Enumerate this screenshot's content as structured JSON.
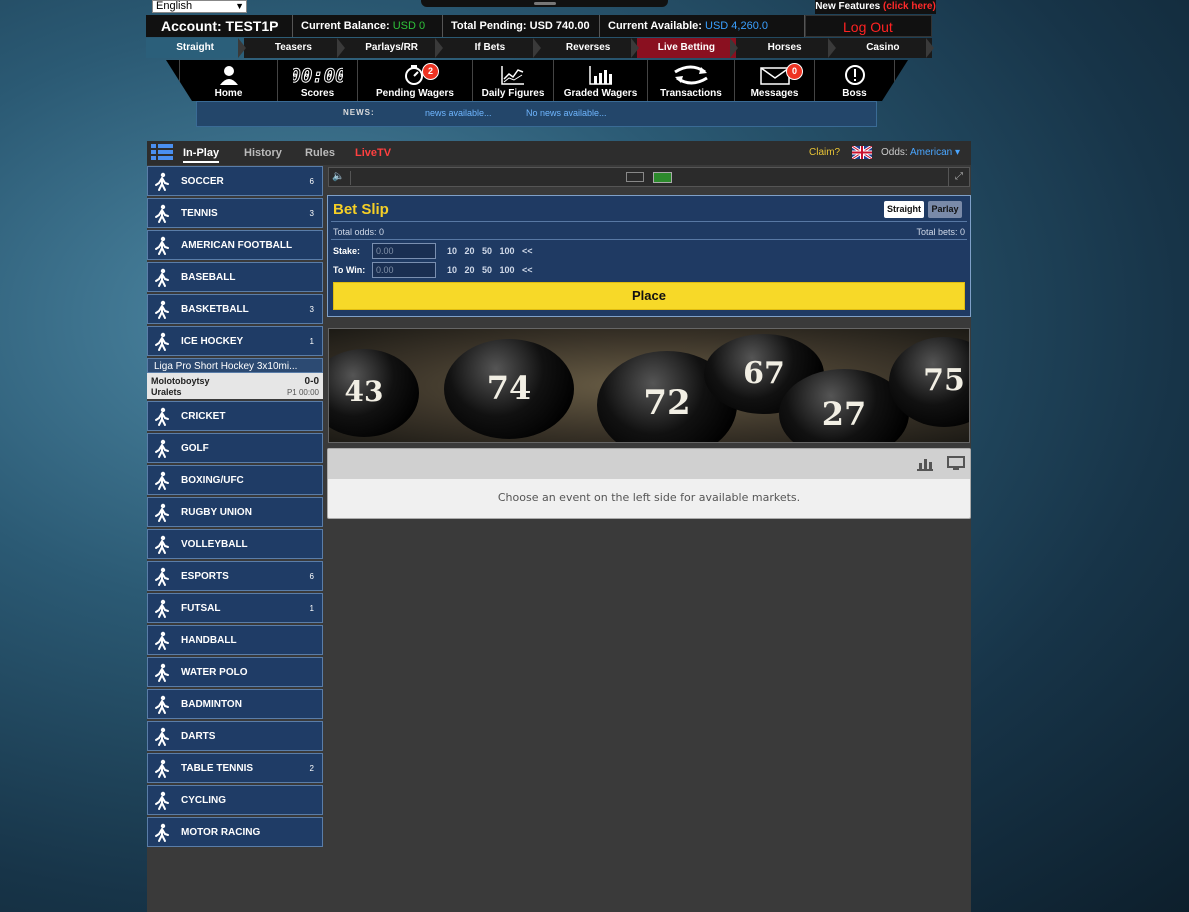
{
  "top": {
    "language": "English",
    "new_features_label": "New Features",
    "new_features_link": "(click here)"
  },
  "account": {
    "name": "Account: TEST1P",
    "balance_label": "Current Balance:",
    "balance_value": "USD 0",
    "pending_label": "Total Pending:",
    "pending_value": "USD 740.00",
    "available_label": "Current Available:",
    "available_value": "USD 4,260.0",
    "logout": "Log Out"
  },
  "bet_types": [
    "Straight",
    "Teasers",
    "Parlays/RR",
    "If Bets",
    "Reverses",
    "Live Betting",
    "Horses",
    "Casino"
  ],
  "nav": {
    "home": "Home",
    "scores": "Scores",
    "pending": "Pending Wagers",
    "pending_badge": "2",
    "daily": "Daily Figures",
    "graded": "Graded Wagers",
    "transactions": "Transactions",
    "messages": "Messages",
    "messages_badge": "0",
    "boss": "Boss"
  },
  "news": {
    "label": "NEWS:",
    "item1": "news available...",
    "item2": "No news available..."
  },
  "tabs": {
    "inplay": "In-Play",
    "history": "History",
    "rules": "Rules",
    "livetv": "LiveTV",
    "claim": "Claim?",
    "odds_label": "Odds:",
    "odds_value": "American ▾"
  },
  "sports": [
    {
      "name": "SOCCER",
      "count": "6",
      "icon": "soccer-player-icon"
    },
    {
      "name": "TENNIS",
      "count": "3",
      "icon": "tennis-player-icon"
    },
    {
      "name": "AMERICAN FOOTBALL",
      "count": "",
      "icon": "football-player-icon"
    },
    {
      "name": "BASEBALL",
      "count": "",
      "icon": "baseball-player-icon"
    },
    {
      "name": "BASKETBALL",
      "count": "3",
      "icon": "basketball-player-icon"
    },
    {
      "name": "ICE HOCKEY",
      "count": "1",
      "icon": "hockey-player-icon"
    },
    {
      "name": "CRICKET",
      "count": "",
      "icon": "cricket-player-icon"
    },
    {
      "name": "GOLF",
      "count": "",
      "icon": "golf-player-icon"
    },
    {
      "name": "BOXING/UFC",
      "count": "",
      "icon": "boxing-icon"
    },
    {
      "name": "RUGBY UNION",
      "count": "",
      "icon": "rugby-player-icon"
    },
    {
      "name": "VOLLEYBALL",
      "count": "",
      "icon": "volleyball-player-icon"
    },
    {
      "name": "ESPORTS",
      "count": "6",
      "icon": "esports-icon"
    },
    {
      "name": "FUTSAL",
      "count": "1",
      "icon": "futsal-player-icon"
    },
    {
      "name": "HANDBALL",
      "count": "",
      "icon": "handball-player-icon"
    },
    {
      "name": "WATER POLO",
      "count": "",
      "icon": "water-polo-icon"
    },
    {
      "name": "BADMINTON",
      "count": "",
      "icon": "badminton-player-icon"
    },
    {
      "name": "DARTS",
      "count": "",
      "icon": "darts-player-icon"
    },
    {
      "name": "TABLE TENNIS",
      "count": "2",
      "icon": "table-tennis-icon"
    },
    {
      "name": "CYCLING",
      "count": "",
      "icon": "cycling-icon"
    },
    {
      "name": "MOTOR RACING",
      "count": "",
      "icon": "motor-racing-icon"
    }
  ],
  "hockey_event": {
    "league": "Liga Pro Short Hockey 3x10mi...",
    "team1": "Molotoboytsy",
    "team2": "Uralets",
    "score": "0-0",
    "period": "P1 00:00"
  },
  "bet_slip": {
    "title": "Bet Slip",
    "straight": "Straight",
    "parlay": "Parlay",
    "total_odds": "Total odds: 0",
    "total_bets": "Total bets: 0",
    "stake_label": "Stake:",
    "towin_label": "To Win:",
    "stake_placeholder": "0.00",
    "towin_placeholder": "0.00",
    "quick_amounts": "10 20 50 100 <<",
    "place": "Place"
  },
  "banner": {
    "balls": [
      "43",
      "74",
      "72",
      "67",
      "27",
      "75"
    ]
  },
  "markets": {
    "message": "Choose an event on the left side for available markets."
  }
}
